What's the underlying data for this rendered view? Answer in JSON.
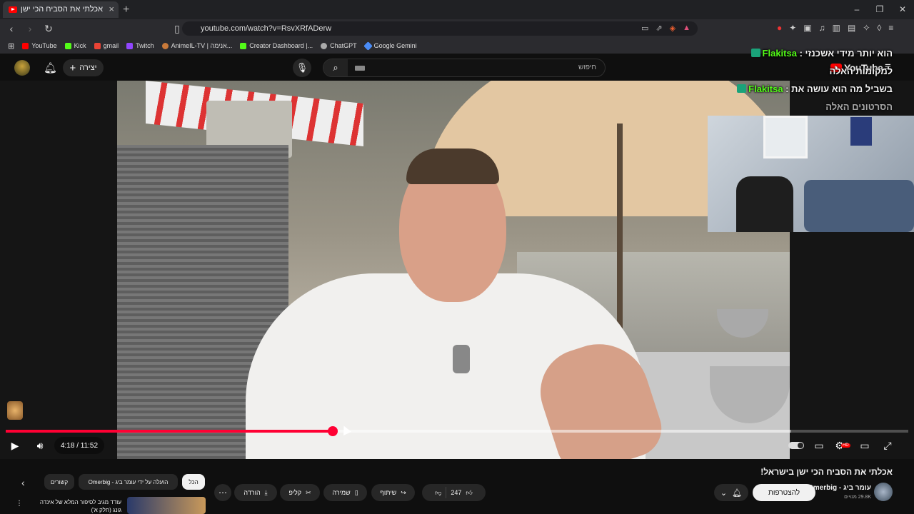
{
  "browser": {
    "tab_title": "אכלתי את הסביח הכי ישן בישרא...",
    "url": "youtube.com/watch?v=RsvXRfADerw",
    "bookmarks": [
      "YouTube",
      "Kick",
      "gmail",
      "Twitch",
      "AnimeIL-TV | אנימה...",
      "Creator Dashboard |...",
      "ChatGPT",
      "Google Gemini"
    ]
  },
  "header": {
    "create_label": "יצירה",
    "search_placeholder": "חיפוש",
    "logo_text": "YouTube"
  },
  "chat_overlay": {
    "messages": [
      {
        "user": "Flakitsa",
        "text_before": "הוא יותר מידי אשכנזי",
        "text_after": "למקומות האלה"
      },
      {
        "user": "Flakitsa",
        "text_before": "בשביל מה הוא עושה את",
        "text_after": "הסרטונים האלה"
      }
    ]
  },
  "player": {
    "current_time": "4:18",
    "duration": "11:52",
    "time_display": "4:18 / 11:52",
    "progress_fraction": 0.3624,
    "buffered_fraction": 0.87,
    "hd_badge": "HD"
  },
  "video": {
    "title": "אכלתי את הסביח הכי ישן בישראל!",
    "channel_name": "עומר ביג - Omerbig",
    "subscribers": "29.8K מנויים",
    "subscribe_label": "להצטרפות",
    "likes": "247",
    "share_label": "שיתוף",
    "save_label": "שמירה",
    "clip_label": "קליפ",
    "download_label": "הורדה"
  },
  "chips": {
    "all": "הכל",
    "by_uploader": "הועלה על ידי עומר ביג - Omerbig",
    "related": "קשורים"
  },
  "recommendation": {
    "title": "עודד מגיב לסיפור המלא של אינדה גונג (חלק א')"
  },
  "colors": {
    "accent_red": "#ff0033",
    "kick_green": "#53fc18",
    "background": "#0f0f0f"
  }
}
